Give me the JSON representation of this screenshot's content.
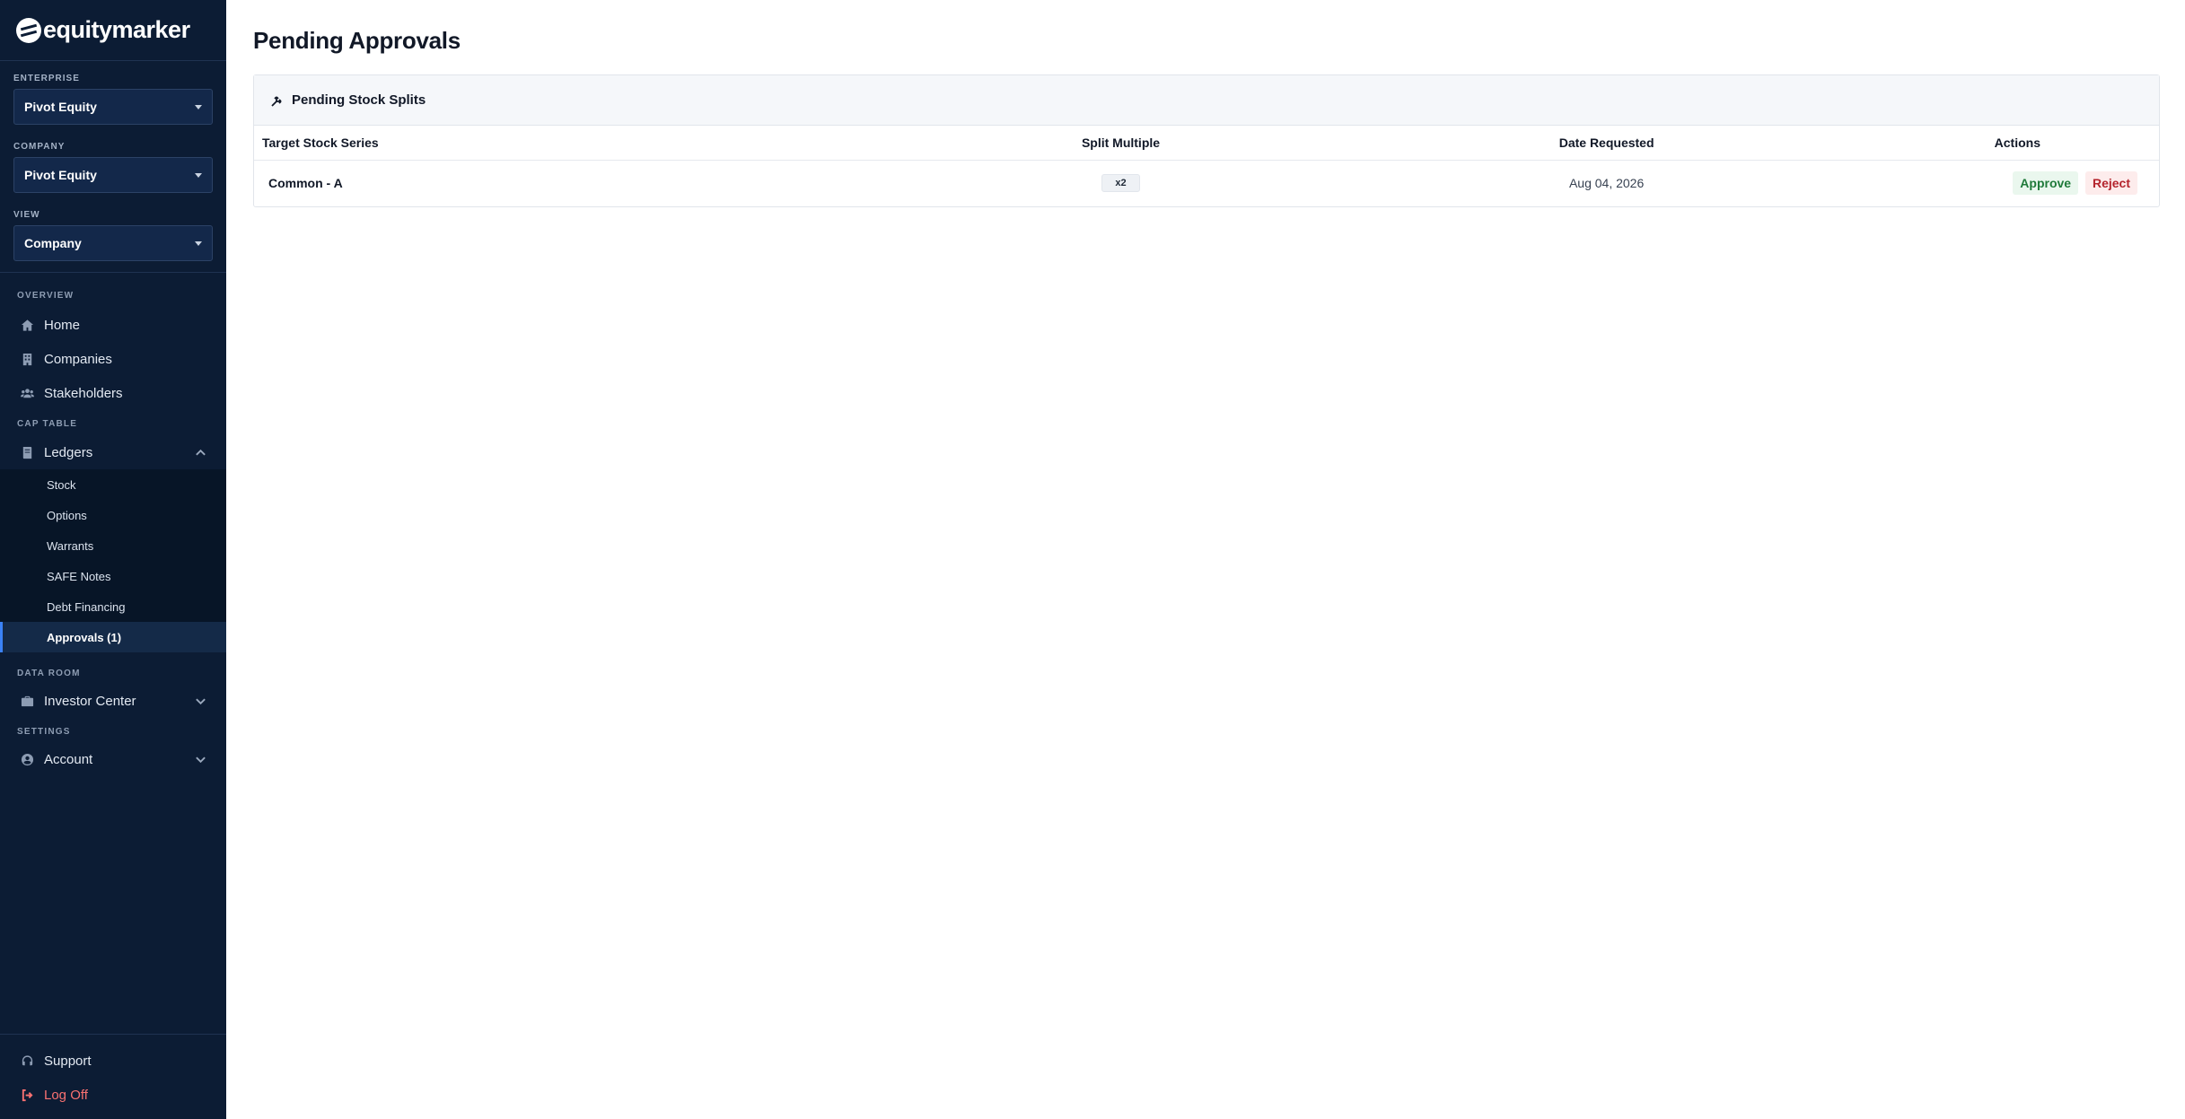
{
  "brand": {
    "name": "equitymarker"
  },
  "selectors": [
    {
      "label": "ENTERPRISE",
      "value": "Pivot Equity"
    },
    {
      "label": "COMPANY",
      "value": "Pivot Equity"
    },
    {
      "label": "VIEW",
      "value": "Company"
    }
  ],
  "nav": {
    "overview_label": "OVERVIEW",
    "overview": [
      {
        "label": "Home",
        "icon": "home-icon"
      },
      {
        "label": "Companies",
        "icon": "building-icon"
      },
      {
        "label": "Stakeholders",
        "icon": "users-icon"
      }
    ],
    "cap_table_label": "CAP TABLE",
    "ledgers": {
      "label": "Ledgers",
      "icon": "ledger-icon",
      "expanded": true
    },
    "ledger_items": [
      "Stock",
      "Options",
      "Warrants",
      "SAFE Notes",
      "Debt Financing",
      "Approvals (1)"
    ],
    "active_item": "Approvals (1)",
    "data_room_label": "DATA ROOM",
    "investor_center": {
      "label": "Investor Center",
      "icon": "briefcase-icon"
    },
    "settings_label": "SETTINGS",
    "account": {
      "label": "Account",
      "icon": "user-circle-icon"
    },
    "support": {
      "label": "Support",
      "icon": "headset-icon"
    },
    "logoff": {
      "label": "Log Off",
      "icon": "logout-icon"
    }
  },
  "page": {
    "title": "Pending Approvals",
    "card_title": "Pending Stock Splits",
    "columns": [
      "Target Stock Series",
      "Split Multiple",
      "Date Requested",
      "Actions"
    ],
    "rows": [
      {
        "series": "Common - A",
        "multiple": "x2",
        "date": "Aug 04, 2026",
        "approve": "Approve",
        "reject": "Reject"
      }
    ]
  },
  "colors": {
    "sidebar": "#0c1c34",
    "active_accent": "#3b82f6",
    "approve": "#1f7a3a",
    "reject": "#b4232c",
    "logoff": "#f87171"
  }
}
